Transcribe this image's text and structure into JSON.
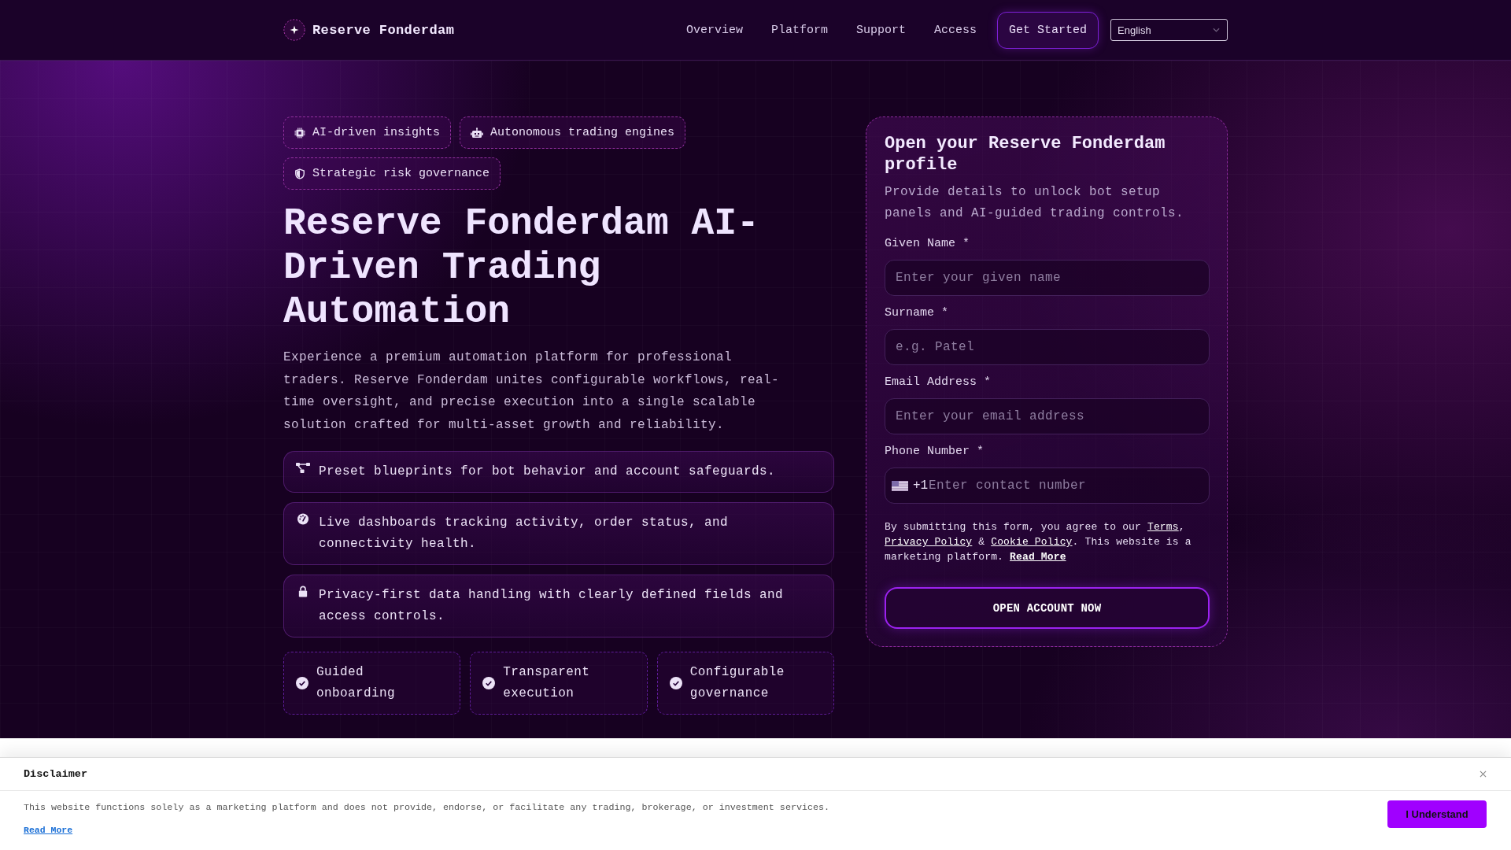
{
  "header": {
    "brand": "Reserve Fonderdam",
    "nav": [
      {
        "label": "Overview"
      },
      {
        "label": "Platform"
      },
      {
        "label": "Support"
      },
      {
        "label": "Access"
      }
    ],
    "cta": "Get Started",
    "language": "English"
  },
  "hero": {
    "chips": [
      "AI-driven insights",
      "Autonomous trading engines",
      "Strategic risk governance"
    ],
    "title": "Reserve Fonderdam AI-Driven Trading Automation",
    "description": "Experience a premium automation platform for professional traders. Reserve Fonderdam unites configurable workflows, real-time oversight, and precise execution into a single scalable solution crafted for multi-asset growth and reliability.",
    "features": [
      "Preset blueprints for bot behavior and account safeguards.",
      "Live dashboards tracking activity, order status, and connectivity health.",
      "Privacy-first data handling with clearly defined fields and access controls."
    ],
    "highlights": [
      "Guided onboarding",
      "Transparent execution",
      "Configurable governance"
    ]
  },
  "signup_form": {
    "title": "Open your Reserve Fonderdam profile",
    "subtitle": "Provide details to unlock bot setup panels and AI-guided trading controls.",
    "fields": [
      {
        "kind": "text",
        "label": "Given Name *",
        "placeholder": "Enter your given name"
      },
      {
        "kind": "text",
        "label": "Surname *",
        "placeholder": "e.g. Patel"
      },
      {
        "kind": "email",
        "label": "Email Address *",
        "placeholder": "Enter your email address"
      },
      {
        "kind": "phone",
        "label": "Phone Number *",
        "country_code": "+1",
        "placeholder": "Enter contact number"
      }
    ],
    "consent": [
      {
        "kind": "text",
        "text": "By submitting this form, you agree to our "
      },
      {
        "kind": "link",
        "text": "Terms"
      },
      {
        "kind": "text",
        "text": ", "
      },
      {
        "kind": "link",
        "text": "Privacy Policy"
      },
      {
        "kind": "text",
        "text": " & "
      },
      {
        "kind": "link",
        "text": "Cookie Policy"
      },
      {
        "kind": "text",
        "text": ". This website is a marketing platform. "
      },
      {
        "kind": "bold-link",
        "text": "Read More"
      }
    ],
    "submit": "OPEN ACCOUNT NOW"
  },
  "disclaimer": {
    "title": "Disclaimer",
    "text": "This website functions solely as a marketing platform and does not provide, endorse, or facilitate any trading, brokerage, or investment services.",
    "link": "Read More",
    "button": "I Understand"
  }
}
